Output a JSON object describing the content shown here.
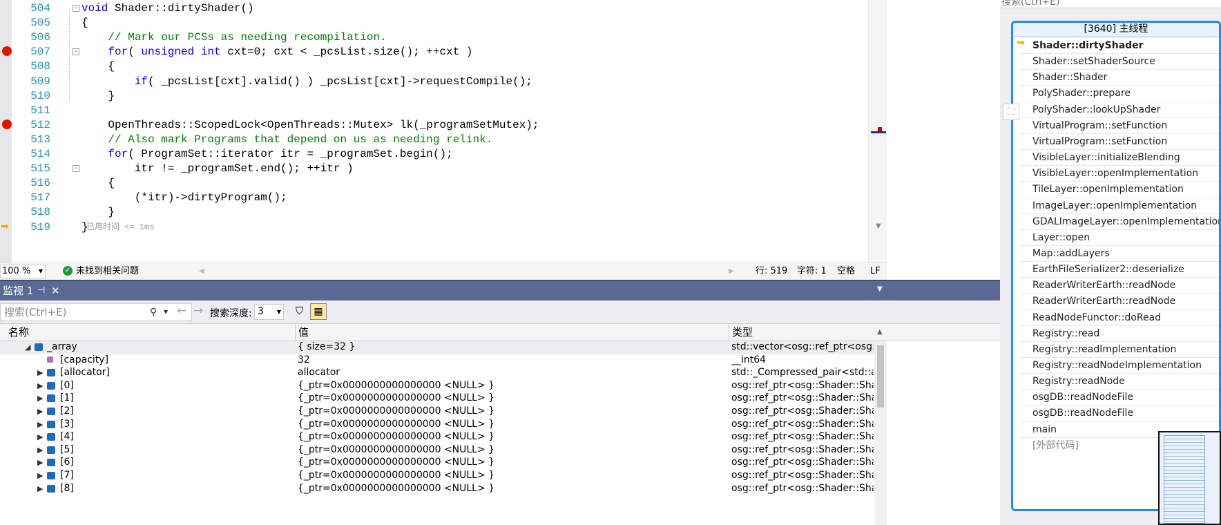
{
  "editor": {
    "lines": [
      {
        "num": "504",
        "parts": [
          {
            "t": "void",
            "c": "kw"
          },
          {
            "t": " Shader::dirtyShader()",
            "c": ""
          }
        ]
      },
      {
        "num": "505",
        "parts": [
          {
            "t": "{",
            "c": ""
          }
        ]
      },
      {
        "num": "506",
        "parts": [
          {
            "t": "    // Mark our PCSs as needing recompilation.",
            "c": "cm"
          }
        ]
      },
      {
        "num": "507",
        "parts": [
          {
            "t": "    for",
            "c": "kw"
          },
          {
            "t": "( ",
            "c": ""
          },
          {
            "t": "unsigned int",
            "c": "kw"
          },
          {
            "t": " cxt=0; cxt < _pcsList.size(); ++cxt )",
            "c": ""
          }
        ]
      },
      {
        "num": "508",
        "parts": [
          {
            "t": "    {",
            "c": ""
          }
        ]
      },
      {
        "num": "509",
        "parts": [
          {
            "t": "        if",
            "c": "kw"
          },
          {
            "t": "( _pcsList[cxt].valid() ) _pcsList[cxt]->requestCompile();",
            "c": ""
          }
        ]
      },
      {
        "num": "510",
        "parts": [
          {
            "t": "    }",
            "c": ""
          }
        ]
      },
      {
        "num": "511",
        "parts": [
          {
            "t": "",
            "c": ""
          }
        ]
      },
      {
        "num": "512",
        "parts": [
          {
            "t": "    OpenThreads::ScopedLock<OpenThreads::Mutex> lk(_programSetMutex);",
            "c": ""
          }
        ]
      },
      {
        "num": "513",
        "parts": [
          {
            "t": "    // Also mark Programs that depend on us as needing relink.",
            "c": "cm"
          }
        ]
      },
      {
        "num": "514",
        "parts": [
          {
            "t": "    for",
            "c": "kw"
          },
          {
            "t": "( ProgramSet::iterator itr = _programSet.begin();",
            "c": ""
          }
        ]
      },
      {
        "num": "515",
        "parts": [
          {
            "t": "        itr != _programSet.end(); ++itr )",
            "c": ""
          }
        ]
      },
      {
        "num": "516",
        "parts": [
          {
            "t": "    {",
            "c": ""
          }
        ]
      },
      {
        "num": "517",
        "parts": [
          {
            "t": "        (*itr)->dirtyProgram();",
            "c": ""
          }
        ]
      },
      {
        "num": "518",
        "parts": [
          {
            "t": "    }",
            "c": ""
          }
        ]
      },
      {
        "num": "519",
        "parts": [
          {
            "t": "}",
            "c": ""
          }
        ]
      }
    ],
    "elapsed_hint": "已用时间 <= 1ms",
    "zoom": "100 %",
    "issues": "未找到相关问题",
    "row": "行: 519",
    "col": "字符: 1",
    "spacing": "空格",
    "eol": "LF"
  },
  "watch": {
    "tab_label": "监视 1",
    "search_placeholder": "搜索(Ctrl+E)",
    "depth_label": "搜索深度:",
    "depth_value": "3",
    "headers": {
      "name": "名称",
      "value": "值",
      "type": "类型"
    },
    "rows": [
      {
        "name": "_array",
        "value": "{ size=32 }",
        "type": "std::vector<osg::ref_ptr<osg::Sha...",
        "expand": "◢",
        "indent": 0
      },
      {
        "name": "[capacity]",
        "value": "32",
        "type": "__int64",
        "expand": "",
        "indent": 1
      },
      {
        "name": "[allocator]",
        "value": "allocator",
        "type": "std::_Compressed_pair<std::alloca...",
        "expand": "▶",
        "indent": 1
      },
      {
        "name": "[0]",
        "value": "{_ptr=0x0000000000000000 <NULL> }",
        "type": "osg::ref_ptr<osg::Shader::ShaderO...",
        "expand": "▶",
        "indent": 1
      },
      {
        "name": "[1]",
        "value": "{_ptr=0x0000000000000000 <NULL> }",
        "type": "osg::ref_ptr<osg::Shader::ShaderO...",
        "expand": "▶",
        "indent": 1
      },
      {
        "name": "[2]",
        "value": "{_ptr=0x0000000000000000 <NULL> }",
        "type": "osg::ref_ptr<osg::Shader::ShaderO...",
        "expand": "▶",
        "indent": 1
      },
      {
        "name": "[3]",
        "value": "{_ptr=0x0000000000000000 <NULL> }",
        "type": "osg::ref_ptr<osg::Shader::ShaderO...",
        "expand": "▶",
        "indent": 1
      },
      {
        "name": "[4]",
        "value": "{_ptr=0x0000000000000000 <NULL> }",
        "type": "osg::ref_ptr<osg::Shader::ShaderO...",
        "expand": "▶",
        "indent": 1
      },
      {
        "name": "[5]",
        "value": "{_ptr=0x0000000000000000 <NULL> }",
        "type": "osg::ref_ptr<osg::Shader::ShaderO...",
        "expand": "▶",
        "indent": 1
      },
      {
        "name": "[6]",
        "value": "{_ptr=0x0000000000000000 <NULL> }",
        "type": "osg::ref_ptr<osg::Shader::ShaderO...",
        "expand": "▶",
        "indent": 1
      },
      {
        "name": "[7]",
        "value": "{_ptr=0x0000000000000000 <NULL> }",
        "type": "osg::ref_ptr<osg::Shader::ShaderO...",
        "expand": "▶",
        "indent": 1
      },
      {
        "name": "[8]",
        "value": "{_ptr=0x0000000000000000 <NULL> }",
        "type": "osg::ref_ptr<osg::Shader::ShaderO...",
        "expand": "▶",
        "indent": 1
      }
    ]
  },
  "callstack": {
    "search_placeholder": "搜索(Ctrl+E)",
    "thread_title": "[3640] 主线程",
    "frames": [
      "Shader::dirtyShader",
      "Shader::setShaderSource",
      "Shader::Shader",
      "PolyShader::prepare",
      "PolyShader::lookUpShader",
      "VirtualProgram::setFunction",
      "VirtualProgram::setFunction",
      "VisibleLayer::initializeBlending",
      "VisibleLayer::openImplementation",
      "TileLayer::openImplementation",
      "ImageLayer::openImplementation",
      "GDALImageLayer::openImplementation",
      "Layer::open",
      "Map::addLayers",
      "EarthFileSerializer2::deserialize",
      "ReaderWriterEarth::readNode",
      "ReaderWriterEarth::readNode",
      "ReadNodeFunctor::doRead",
      "Registry::read",
      "Registry::readImplementation",
      "Registry::readNodeImplementation",
      "Registry::readNode",
      "osgDB::readNodeFile",
      "osgDB::readNodeFile",
      "main",
      "[外部代码]"
    ]
  },
  "colors": {
    "keyword": "#0000ff",
    "comment": "#008000",
    "linenum": "#2b91af",
    "breakpoint": "#e51400",
    "accent": "#1e8cf0"
  }
}
